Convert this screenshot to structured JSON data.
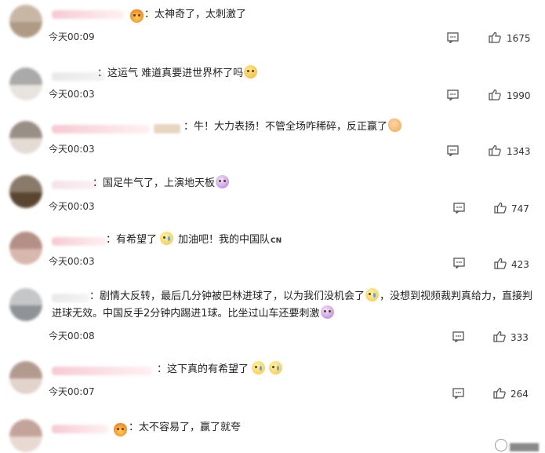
{
  "comments": [
    {
      "text_parts": [
        "：太神奇了，太刺激了"
      ],
      "time": "今天00:09",
      "likes": "1675"
    },
    {
      "text_parts": [
        "：这运气 难道真要进世界杯了吗"
      ],
      "time": "今天00:03",
      "likes": "1990"
    },
    {
      "text_parts": [
        "：牛！大力表扬！不管全场咋稀碎，反正赢了"
      ],
      "time": "今天00:03",
      "likes": "1343"
    },
    {
      "text_parts": [
        "：国足牛气了，上演地天板"
      ],
      "time": "今天00:03",
      "likes": "747"
    },
    {
      "text_parts": [
        "：有希望了",
        "加油吧！我的中国队"
      ],
      "flag_label": "CN",
      "time": "今天00:03",
      "likes": "423"
    },
    {
      "text_parts": [
        "：剧情大反转，最后几分钟被巴林进球了，以为我们没机会了",
        "，没想到视频裁判真给力，直接判进球无效。中国反手2分钟内踢进1球。比坐过山车还要刺激"
      ],
      "time": "今天00:08",
      "likes": "333"
    },
    {
      "text_parts": [
        "：这下真的有希望了"
      ],
      "time": "今天00:07",
      "likes": "264"
    },
    {
      "text_parts": [
        "：太不容易了，赢了就夸"
      ]
    }
  ],
  "icons": {
    "reply": "comment-reply-icon",
    "like": "thumbs-up-icon"
  },
  "watermark": {
    "logo": "watermark-logo-icon"
  },
  "colors": {
    "text": "#222222",
    "meta": "#333333",
    "icon": "#555555",
    "name_blur": "#f6c9d3"
  }
}
